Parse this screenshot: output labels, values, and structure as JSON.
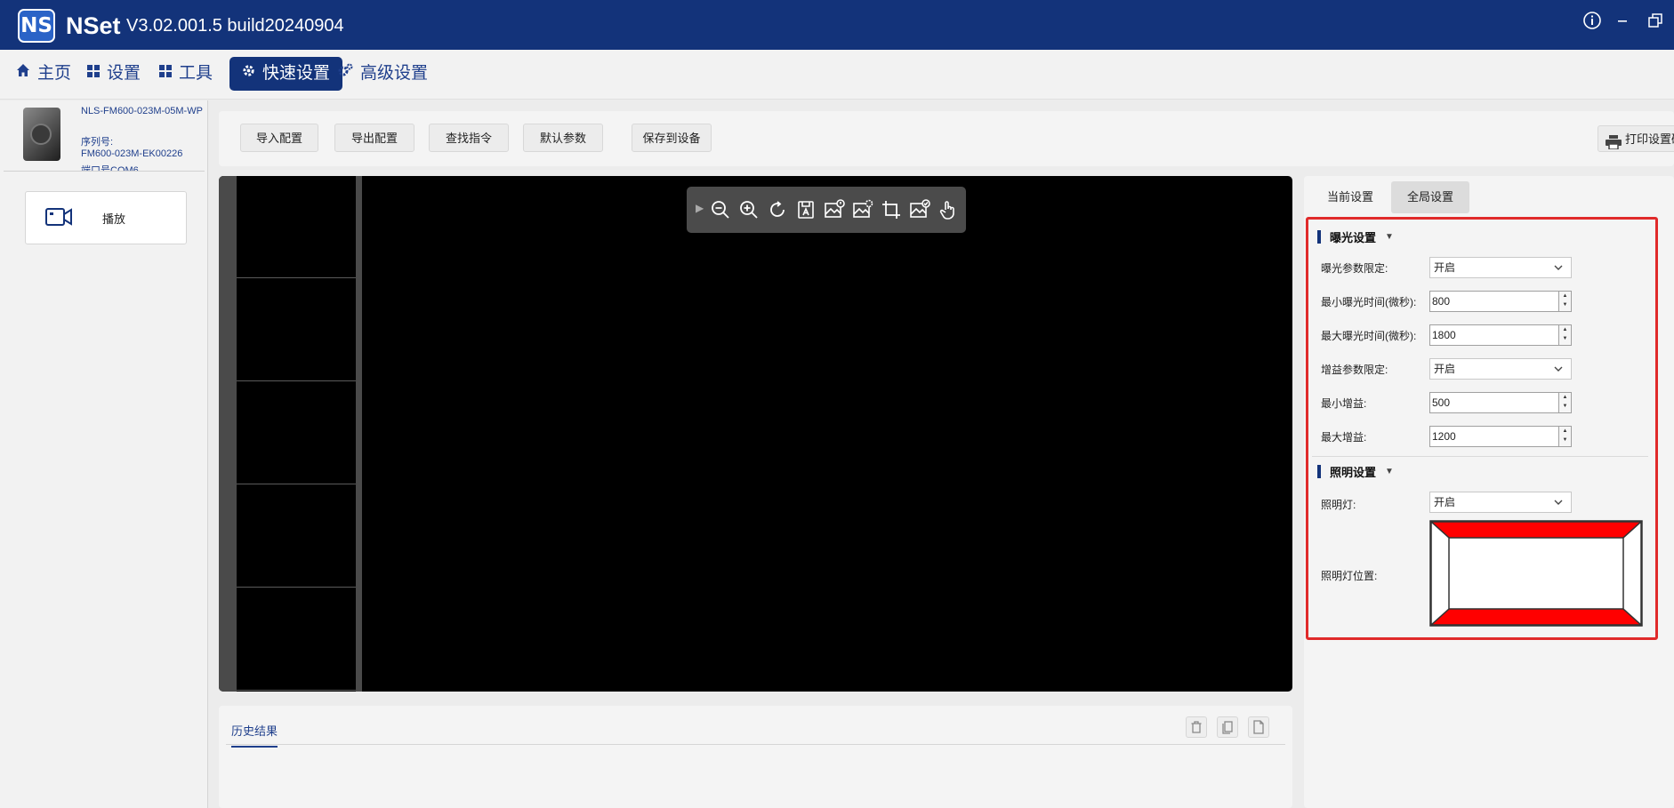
{
  "app": {
    "logo_text": "NS",
    "name": "NSet",
    "version": "V3.02.001.5 build20240904",
    "controls": {
      "info_icon": "info-icon",
      "minimize_icon": "minimize-icon",
      "restore_icon": "restore-icon"
    }
  },
  "menu": [
    {
      "label": "主页",
      "icon": "home-icon"
    },
    {
      "label": "设置",
      "icon": "grid-icon"
    },
    {
      "label": "工具",
      "icon": "grid-icon"
    },
    {
      "label": "快速设置",
      "icon": "gear-icon",
      "active": true
    },
    {
      "label": "高级设置",
      "icon": "gears-icon"
    }
  ],
  "device": {
    "model": "NLS-FM600-023M-05M-WP",
    "serial_label": "序列号:",
    "serial": "FM600-023M-EK00226",
    "port": "端口号COM6"
  },
  "sidebar": {
    "play_label": "播放"
  },
  "toolbar": {
    "buttons": [
      "导入配置",
      "导出配置",
      "查找指令",
      "默认参数",
      "保存到设备"
    ],
    "print_label": "打印设置码"
  },
  "viewer": {
    "tools": [
      "zoom-out-icon",
      "zoom-in-icon",
      "rotate-icon",
      "save-image-icon",
      "image-info-icon",
      "image-settings-icon",
      "crop-icon",
      "image-check-icon",
      "hand-pointer-icon"
    ]
  },
  "history": {
    "tab_label": "历史结果"
  },
  "settings": {
    "tabs": [
      "当前设置",
      "全局设置"
    ],
    "active_tab": "全局设置",
    "exposure": {
      "title": "曝光设置",
      "limit_label": "曝光参数限定:",
      "limit_value": "开启",
      "min_time_label": "最小曝光时间(微秒):",
      "min_time_value": "800",
      "max_time_label": "最大曝光时间(微秒):",
      "max_time_value": "1800",
      "gain_limit_label": "增益参数限定:",
      "gain_limit_value": "开启",
      "min_gain_label": "最小增益:",
      "min_gain_value": "500",
      "max_gain_label": "最大增益:",
      "max_gain_value": "1200"
    },
    "lighting": {
      "title": "照明设置",
      "light_label": "照明灯:",
      "light_value": "开启",
      "position_label": "照明灯位置:"
    }
  },
  "colors": {
    "titlebar": "#13337a",
    "accent": "#1f3f8c",
    "highlight_frame": "#e02a2a",
    "light_active": "#ff0000"
  }
}
